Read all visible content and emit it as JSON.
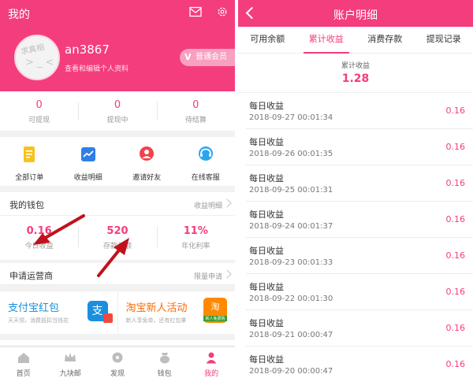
{
  "left": {
    "header": {
      "title": "我的",
      "icons": [
        "mail-icon",
        "gear-icon"
      ],
      "avatar_text": "求真相",
      "avatar_face": "> _ <",
      "username": "an3867",
      "profile_link": "查看和编辑个人资料",
      "member_badge": "普通会员"
    },
    "stats": [
      {
        "value": "0",
        "label": "可提现"
      },
      {
        "value": "0",
        "label": "提现中"
      },
      {
        "value": "0",
        "label": "待结算"
      }
    ],
    "menu": [
      {
        "label": "全部订单",
        "icon": "orders-icon"
      },
      {
        "label": "收益明细",
        "icon": "earnings-chart-icon"
      },
      {
        "label": "邀请好友",
        "icon": "invite-friend-icon"
      },
      {
        "label": "在线客服",
        "icon": "customer-service-icon"
      }
    ],
    "wallet": {
      "title": "我的钱包",
      "link": "收益明细",
      "stats": [
        {
          "value": "0.16",
          "label": "今日收益"
        },
        {
          "value": "520",
          "label": "存款总额"
        },
        {
          "value": "11%",
          "label": "年化利率"
        }
      ]
    },
    "operator": {
      "title": "申请运营商",
      "link": "限量申请"
    },
    "promos": [
      {
        "title": "支付宝红包",
        "subtitle": "天天领，消费抵扣当钱花",
        "icon": "alipay-icon",
        "icon_glyph": "支"
      },
      {
        "title": "淘宝新人活动",
        "subtitle": "新人享免单，还有红包拿",
        "icon": "taobao-icon",
        "icon_glyph": "淘",
        "icon_tag": "新人免费购"
      }
    ],
    "tabbar": [
      {
        "label": "首页",
        "icon": "home-icon"
      },
      {
        "label": "九块邮",
        "icon": "crown-icon"
      },
      {
        "label": "发现",
        "icon": "discover-icon"
      },
      {
        "label": "钱包",
        "icon": "wallet-icon"
      },
      {
        "label": "我的",
        "icon": "profile-icon",
        "active": true
      }
    ]
  },
  "right": {
    "header": {
      "title": "账户明细"
    },
    "tabs": [
      {
        "label": "可用余额"
      },
      {
        "label": "累计收益",
        "active": true
      },
      {
        "label": "消费存款"
      },
      {
        "label": "提现记录"
      }
    ],
    "summary": {
      "label": "累计收益",
      "value": "1.28"
    },
    "ledger": [
      {
        "title": "每日收益",
        "time": "2018-09-27 00:01:34",
        "amount": "0.16"
      },
      {
        "title": "每日收益",
        "time": "2018-09-26 00:01:35",
        "amount": "0.16"
      },
      {
        "title": "每日收益",
        "time": "2018-09-25 00:01:31",
        "amount": "0.16"
      },
      {
        "title": "每日收益",
        "time": "2018-09-24 00:01:37",
        "amount": "0.16"
      },
      {
        "title": "每日收益",
        "time": "2018-09-23 00:01:33",
        "amount": "0.16"
      },
      {
        "title": "每日收益",
        "time": "2018-09-22 00:01:30",
        "amount": "0.16"
      },
      {
        "title": "每日收益",
        "time": "2018-09-21 00:00:47",
        "amount": "0.16"
      },
      {
        "title": "每日收益",
        "time": "2018-09-20 00:00:47",
        "amount": "0.16"
      }
    ]
  },
  "colors": {
    "accent": "#f43d7c",
    "alipay": "#1a8fe0",
    "taobao": "#ff6a00",
    "arrow": "#c0121d"
  }
}
